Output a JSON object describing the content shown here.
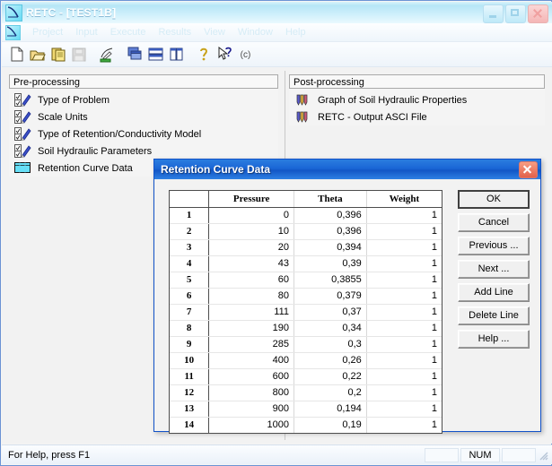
{
  "window": {
    "title": "RETC - [TEST1B]",
    "icon": "retc-curve-icon",
    "buttons": {
      "minimize": "minimize-button",
      "maximize": "maximize-button",
      "close": "close-button"
    }
  },
  "menubar": {
    "icon": "retc-curve-icon",
    "items": [
      {
        "label": "Project"
      },
      {
        "label": "Input"
      },
      {
        "label": "Execute"
      },
      {
        "label": "Results"
      },
      {
        "label": "View"
      },
      {
        "label": "Window"
      },
      {
        "label": "Help"
      }
    ]
  },
  "toolbar": {
    "buttons": [
      {
        "name": "new-file-icon"
      },
      {
        "name": "open-folder-icon"
      },
      {
        "name": "copy-icon"
      },
      {
        "name": "save-icon"
      },
      {
        "name": "execute-icon"
      },
      {
        "name": "cascade-windows-icon"
      },
      {
        "name": "tile-horizontal-icon"
      },
      {
        "name": "tile-vertical-icon"
      },
      {
        "name": "help-icon"
      },
      {
        "name": "context-help-icon"
      },
      {
        "name": "copyright-icon"
      }
    ]
  },
  "preprocessing": {
    "header": "Pre-processing",
    "items": [
      {
        "label": "Type of Problem",
        "icon": "checked-pencil-icon"
      },
      {
        "label": "Scale Units",
        "icon": "checked-pencil-icon"
      },
      {
        "label": "Type of Retention/Conductivity Model",
        "icon": "checked-pencil-icon"
      },
      {
        "label": "Soil Hydraulic Parameters",
        "icon": "checked-pencil-icon"
      },
      {
        "label": "Retention Curve Data",
        "icon": "active-table-icon"
      }
    ]
  },
  "postprocessing": {
    "header": "Post-processing",
    "items": [
      {
        "label": "Graph of Soil Hydraulic Properties",
        "icon": "color-bars-icon"
      },
      {
        "label": "RETC - Output ASCI File",
        "icon": "color-bars-icon"
      }
    ]
  },
  "dialog": {
    "title": "Retention Curve Data",
    "close_icon": "close-icon",
    "columns": [
      "",
      "Pressure",
      "Theta",
      "Weight"
    ],
    "rows": [
      {
        "idx": "1",
        "pressure": "0",
        "theta": "0,396",
        "weight": "1"
      },
      {
        "idx": "2",
        "pressure": "10",
        "theta": "0,396",
        "weight": "1"
      },
      {
        "idx": "3",
        "pressure": "20",
        "theta": "0,394",
        "weight": "1"
      },
      {
        "idx": "4",
        "pressure": "43",
        "theta": "0,39",
        "weight": "1"
      },
      {
        "idx": "5",
        "pressure": "60",
        "theta": "0,3855",
        "weight": "1"
      },
      {
        "idx": "6",
        "pressure": "80",
        "theta": "0,379",
        "weight": "1"
      },
      {
        "idx": "7",
        "pressure": "111",
        "theta": "0,37",
        "weight": "1"
      },
      {
        "idx": "8",
        "pressure": "190",
        "theta": "0,34",
        "weight": "1"
      },
      {
        "idx": "9",
        "pressure": "285",
        "theta": "0,3",
        "weight": "1"
      },
      {
        "idx": "10",
        "pressure": "400",
        "theta": "0,26",
        "weight": "1"
      },
      {
        "idx": "11",
        "pressure": "600",
        "theta": "0,22",
        "weight": "1"
      },
      {
        "idx": "12",
        "pressure": "800",
        "theta": "0,2",
        "weight": "1"
      },
      {
        "idx": "13",
        "pressure": "900",
        "theta": "0,194",
        "weight": "1"
      },
      {
        "idx": "14",
        "pressure": "1000",
        "theta": "0,19",
        "weight": "1"
      }
    ],
    "buttons": [
      {
        "label": "OK",
        "name": "ok-button",
        "default": true
      },
      {
        "label": "Cancel",
        "name": "cancel-button",
        "default": false
      },
      {
        "label": "Previous ...",
        "name": "previous-button",
        "default": false
      },
      {
        "label": "Next ...",
        "name": "next-button",
        "default": false
      },
      {
        "label": "Add Line",
        "name": "add-line-button",
        "default": false
      },
      {
        "label": "Delete Line",
        "name": "delete-line-button",
        "default": false
      },
      {
        "label": "Help ...",
        "name": "help-button",
        "default": false
      }
    ]
  },
  "statusbar": {
    "message": "For Help, press F1",
    "indicators": [
      "",
      "NUM",
      ""
    ]
  },
  "colors": {
    "dialog_title": "#1a66d6",
    "window_title": "#b6e6f6",
    "active_item": "#66e0f7",
    "pencil": "#3b4fc8"
  }
}
